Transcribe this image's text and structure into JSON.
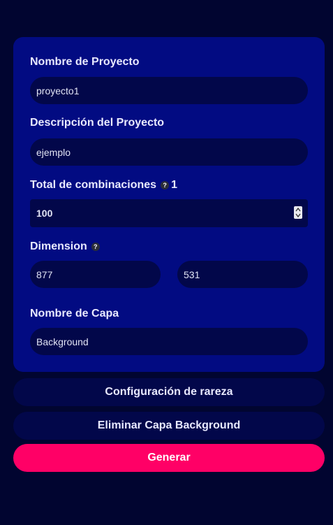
{
  "form": {
    "project_name": {
      "label": "Nombre de Proyecto",
      "value": "proyecto1"
    },
    "project_description": {
      "label": "Descripción del Proyecto",
      "value": "ejemplo"
    },
    "total_combinations": {
      "label": "Total de combinaciones",
      "help_icon": "question-icon",
      "suffix": "1",
      "value": "100"
    },
    "dimension": {
      "label": "Dimension",
      "help_icon": "question-icon",
      "width_value": "877",
      "height_value": "531"
    },
    "layer_name": {
      "label": "Nombre de Capa",
      "value": "Background"
    }
  },
  "actions": {
    "rarity_config_label": "Configuración de rareza",
    "delete_layer_label": "Eliminar Capa Background",
    "generate_label": "Generar"
  },
  "colors": {
    "page_background": "#010530",
    "panel_background": "#020b82",
    "field_background": "#02074a",
    "accent": "#ff0066"
  }
}
